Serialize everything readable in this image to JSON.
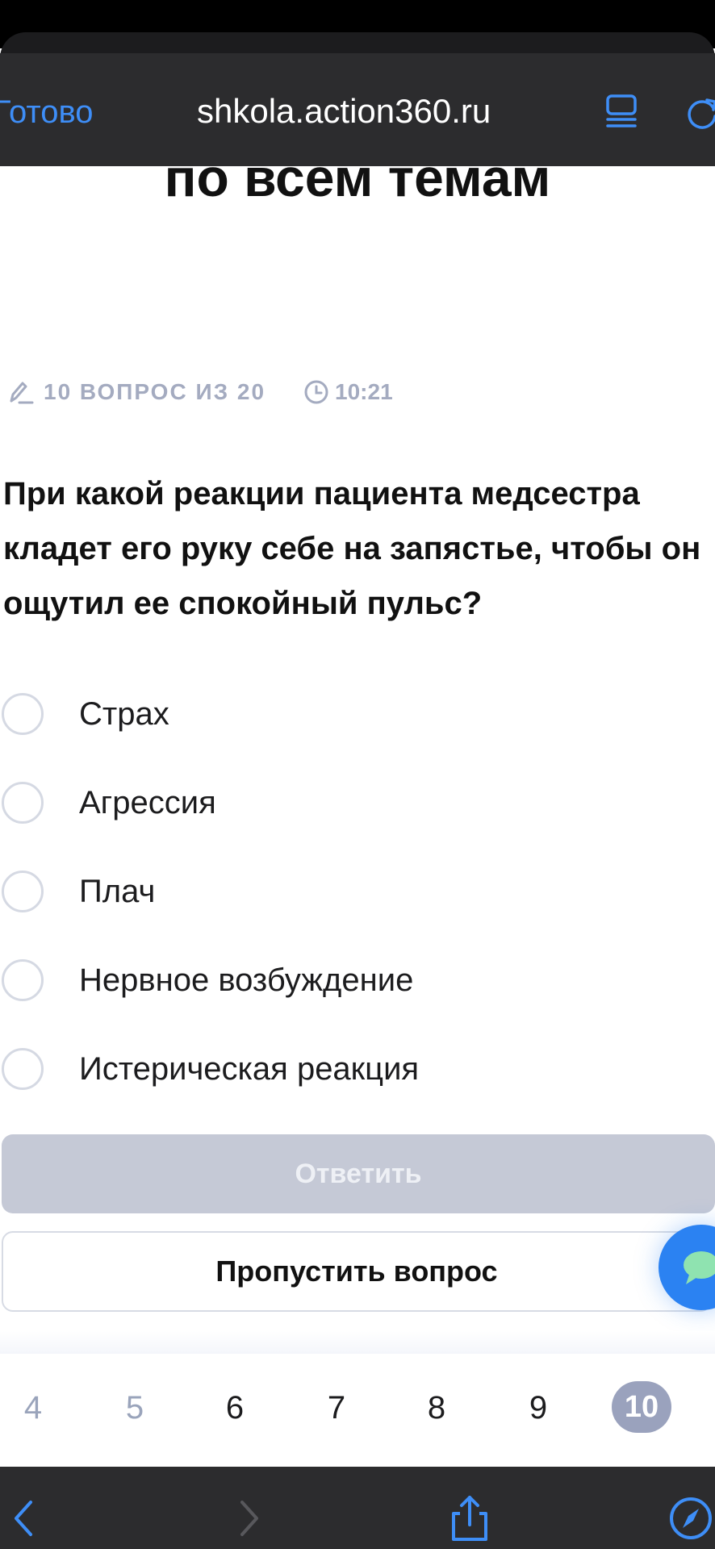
{
  "browser": {
    "done_label": "Готово",
    "url": "shkola.action360.ru"
  },
  "page": {
    "heading_fragment": "по всем темам"
  },
  "quiz": {
    "progress_text": "10 ВОПРОС ИЗ 20",
    "timer_text": "10:21",
    "question": "При какой реакции пациента медсестра кладет его руку себе на запястье, чтобы он ощутил ее спокойный пульс?",
    "options": [
      {
        "label": "Страх"
      },
      {
        "label": "Агрессия"
      },
      {
        "label": "Плач"
      },
      {
        "label": "Нервное возбуждение"
      },
      {
        "label": "Истерическая реакция"
      }
    ],
    "answer_button": "Ответить",
    "skip_button": "Пропустить вопрос"
  },
  "pagination": {
    "pages": [
      "4",
      "5",
      "6",
      "7",
      "8",
      "9",
      "10"
    ],
    "current": "10"
  },
  "colors": {
    "accent_blue": "#2b82f2",
    "muted_gray": "#a4abc0",
    "disabled_button": "#c5c9d6",
    "toolbar": "#2c2c2e"
  }
}
